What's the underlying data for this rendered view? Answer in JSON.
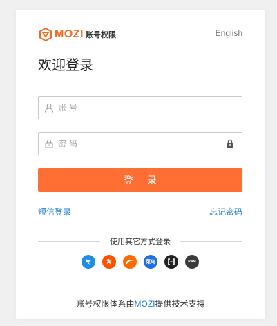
{
  "brand": {
    "word": "MOZI",
    "subtitle": "账号权限"
  },
  "language_link": "English",
  "title": "欢迎登录",
  "username": {
    "placeholder": "账号",
    "value": ""
  },
  "password": {
    "placeholder": "密码",
    "value": ""
  },
  "login_button": "登 录",
  "links": {
    "sms_login": "短信登录",
    "forgot_password": "忘记密码"
  },
  "other_methods_label": "使用其它方式登录",
  "providers": [
    {
      "name": "dingtalk",
      "label": ""
    },
    {
      "name": "taobao",
      "label": "淘"
    },
    {
      "name": "alibaba",
      "label": ""
    },
    {
      "name": "cainiao",
      "label": "菜鸟"
    },
    {
      "name": "aliyun",
      "label": ""
    },
    {
      "name": "ram",
      "label": "RAM"
    }
  ],
  "footer": {
    "prefix": "账号权限体系由",
    "brand": "MOZI",
    "suffix": "提供技术支持"
  },
  "colors": {
    "accent": "#ff6e32",
    "link": "#1e7fd1",
    "brand": "#f26d22"
  }
}
